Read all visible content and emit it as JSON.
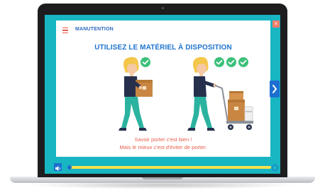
{
  "module": {
    "title": "MANUTENTION",
    "close_label": "×"
  },
  "slide": {
    "heading": "UTILISEZ LE MATÉRIEL À DISPOSITION",
    "caption_line1": "Savoir porter c'est bien !",
    "caption_line2": "Mais le mieux c'est d'éviter de porter.",
    "left_scene": {
      "checks": 1,
      "description_icon": "person-carrying-box-icon"
    },
    "right_scene": {
      "checks": 3,
      "description_icon": "person-pushing-trolley-icon"
    }
  },
  "navigation": {
    "prev_icon": "chevron-left-icon",
    "next_icon": "chevron-right-icon"
  },
  "player": {
    "progress": 0.0,
    "volume_icon": "speaker-icon"
  },
  "colors": {
    "teal": "#18b5c2",
    "blue": "#1c6fd1",
    "coral": "#e95b4a",
    "check_green": "#3cc07a",
    "progress_yellow": "#f6e04d"
  }
}
